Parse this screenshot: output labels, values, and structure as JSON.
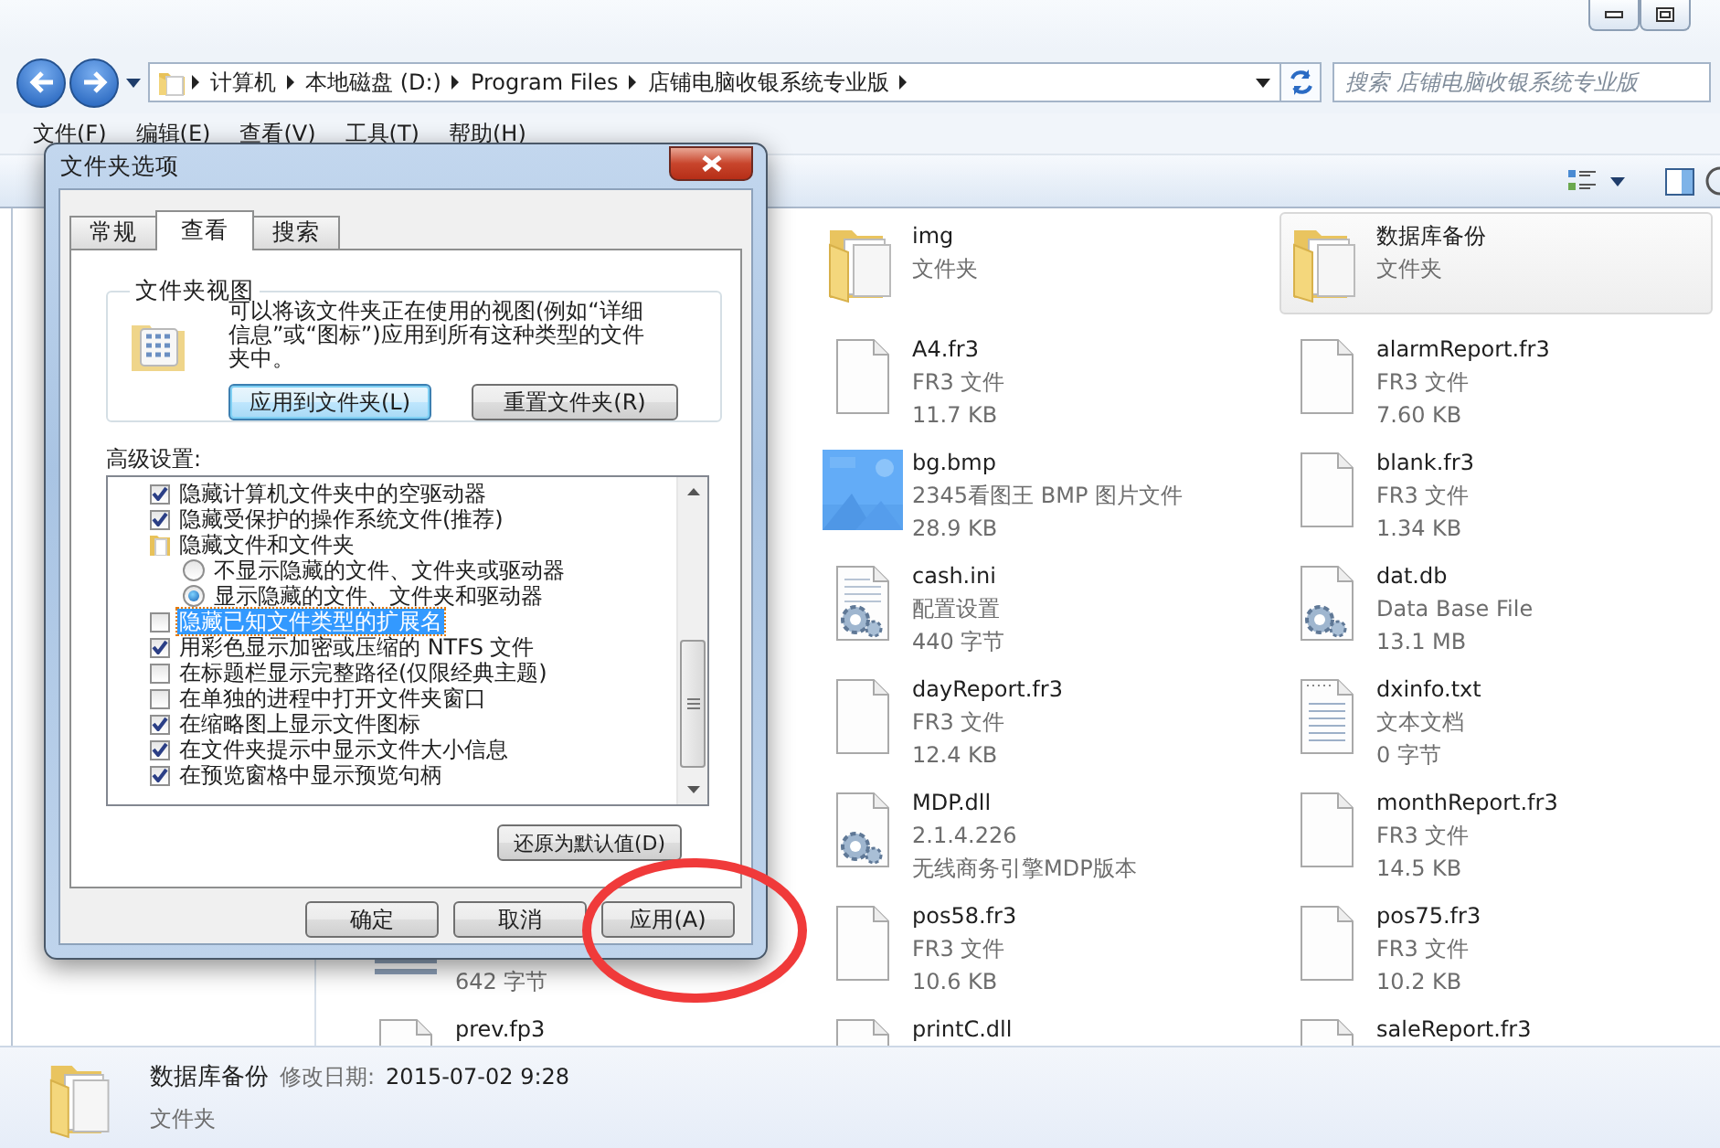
{
  "address_bar": {
    "crumbs": [
      "计算机",
      "本地磁盘 (D:)",
      "Program Files",
      "店铺电脑收银系统专业版"
    ]
  },
  "search": {
    "placeholder": "搜索 店铺电脑收银系统专业版"
  },
  "menu": [
    "文件(F)",
    "编辑(E)",
    "查看(V)",
    "工具(T)",
    "帮助(H)"
  ],
  "files": {
    "columns": [
      [
        {
          "kind": "list",
          "details": [
            "642 字节"
          ],
          "selected": false
        },
        {
          "kind": "blank",
          "name": "prev.fp3",
          "selected": false
        }
      ],
      [
        {
          "kind": "folder",
          "name": "img",
          "details": [
            "文件夹"
          ],
          "selected": false
        },
        {
          "kind": "blank",
          "name": "A4.fr3",
          "details": [
            "FR3 文件",
            "11.7 KB"
          ],
          "selected": false
        },
        {
          "kind": "picture",
          "name": "bg.bmp",
          "details": [
            "2345看图王 BMP 图片文件",
            "28.9 KB"
          ],
          "selected": false
        },
        {
          "kind": "settings",
          "name": "cash.ini",
          "details": [
            "配置设置",
            "440 字节"
          ],
          "selected": false
        },
        {
          "kind": "blank",
          "name": "dayReport.fr3",
          "details": [
            "FR3 文件",
            "12.4 KB"
          ],
          "selected": false
        },
        {
          "kind": "gear",
          "name": "MDP.dll",
          "details": [
            "2.1.4.226",
            "无线商务引擎MDP版本"
          ],
          "selected": false
        },
        {
          "kind": "blank",
          "name": "pos58.fr3",
          "details": [
            "FR3 文件",
            "10.6 KB"
          ],
          "selected": false
        },
        {
          "kind": "blank",
          "name": "printC.dll",
          "selected": false
        }
      ],
      [
        {
          "kind": "folder",
          "name": "数据库备份",
          "details": [
            "文件夹"
          ],
          "selected": true
        },
        {
          "kind": "blank",
          "name": "alarmReport.fr3",
          "details": [
            "FR3 文件",
            "7.60 KB"
          ],
          "selected": false
        },
        {
          "kind": "blank",
          "name": "blank.fr3",
          "details": [
            "FR3 文件",
            "1.34 KB"
          ],
          "selected": false
        },
        {
          "kind": "gear",
          "name": "dat.db",
          "details": [
            "Data Base File",
            "13.1 MB"
          ],
          "selected": false
        },
        {
          "kind": "text",
          "name": "dxinfo.txt",
          "details": [
            "文本文档",
            "0 字节"
          ],
          "selected": false
        },
        {
          "kind": "blank",
          "name": "monthReport.fr3",
          "details": [
            "FR3 文件",
            "14.5 KB"
          ],
          "selected": false
        },
        {
          "kind": "blank",
          "name": "pos75.fr3",
          "details": [
            "FR3 文件",
            "10.2 KB"
          ],
          "selected": false
        },
        {
          "kind": "blank",
          "name": "saleReport.fr3",
          "selected": false
        }
      ]
    ]
  },
  "details": {
    "name": "数据库备份",
    "date_label": "修改日期:",
    "date": "2015-07-02 9:28",
    "type": "文件夹"
  },
  "dialog": {
    "title": "文件夹选项",
    "tabs": [
      {
        "label": "常规",
        "selected": false
      },
      {
        "label": "查看",
        "selected": true
      },
      {
        "label": "搜索",
        "selected": false
      }
    ],
    "folder_views": {
      "legend": "文件夹视图",
      "description": "可以将该文件夹正在使用的视图(例如“详细信息”或“图标”)应用到所有这种类型的文件夹中。",
      "buttons": [
        {
          "label": "应用到文件夹(L)",
          "default": true
        },
        {
          "label": "重置文件夹(R)",
          "default": false
        }
      ]
    },
    "advanced_label": "高级设置:",
    "settings": [
      {
        "kind": "checkbox",
        "label": "隐藏计算机文件夹中的空驱动器",
        "checked": true,
        "selected": false
      },
      {
        "kind": "checkbox",
        "label": "隐藏受保护的操作系统文件(推荐)",
        "checked": true,
        "selected": false
      },
      {
        "kind": "folder",
        "label": "隐藏文件和文件夹",
        "selected": false,
        "children": [
          {
            "kind": "radio",
            "label": "不显示隐藏的文件、文件夹或驱动器",
            "checked": false
          },
          {
            "kind": "radio",
            "label": "显示隐藏的文件、文件夹和驱动器",
            "checked": true
          }
        ]
      },
      {
        "kind": "checkbox",
        "label": "隐藏已知文件类型的扩展名",
        "checked": false,
        "selected": true
      },
      {
        "kind": "checkbox",
        "label": "用彩色显示加密或压缩的 NTFS 文件",
        "checked": true,
        "selected": false
      },
      {
        "kind": "checkbox",
        "label": "在标题栏显示完整路径(仅限经典主题)",
        "checked": false,
        "selected": false
      },
      {
        "kind": "checkbox",
        "label": "在单独的进程中打开文件夹窗口",
        "checked": false,
        "selected": false
      },
      {
        "kind": "checkbox",
        "label": "在缩略图上显示文件图标",
        "checked": true,
        "selected": false
      },
      {
        "kind": "checkbox",
        "label": "在文件夹提示中显示文件大小信息",
        "checked": true,
        "selected": false
      },
      {
        "kind": "checkbox",
        "label": "在预览窗格中显示预览句柄",
        "checked": true,
        "selected": false
      }
    ],
    "restore_button": "还原为默认值(D)",
    "buttons": [
      "确定",
      "取消",
      "应用(A)"
    ]
  },
  "annotation": {
    "kind": "ellipse"
  }
}
